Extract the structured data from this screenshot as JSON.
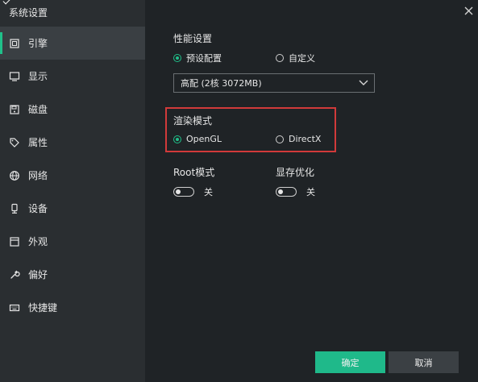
{
  "window": {
    "title": "系统设置"
  },
  "sidebar": {
    "items": [
      {
        "label": "引擎",
        "icon": "cpu-icon",
        "active": true
      },
      {
        "label": "显示",
        "icon": "monitor-icon",
        "active": false
      },
      {
        "label": "磁盘",
        "icon": "disk-icon",
        "active": false
      },
      {
        "label": "属性",
        "icon": "tag-icon",
        "active": false
      },
      {
        "label": "网络",
        "icon": "globe-icon",
        "active": false
      },
      {
        "label": "设备",
        "icon": "device-icon",
        "active": false
      },
      {
        "label": "外观",
        "icon": "window-icon",
        "active": false
      },
      {
        "label": "偏好",
        "icon": "wrench-icon",
        "active": false
      },
      {
        "label": "快捷键",
        "icon": "keyboard-icon",
        "active": false
      }
    ]
  },
  "performance": {
    "label": "性能设置",
    "options": [
      {
        "label": "预设配置",
        "selected": true
      },
      {
        "label": "自定义",
        "selected": false
      }
    ],
    "select_value": "高配 (2核 3072MB)"
  },
  "render": {
    "label": "渲染模式",
    "options": [
      {
        "label": "OpenGL",
        "selected": true
      },
      {
        "label": "DirectX",
        "selected": false
      }
    ]
  },
  "toggles": {
    "root": {
      "label": "Root模式",
      "state": "关"
    },
    "memory": {
      "label": "显存优化",
      "state": "关"
    }
  },
  "buttons": {
    "ok": "确定",
    "cancel": "取消"
  },
  "colors": {
    "accent": "#20c08a",
    "highlight": "#d13a3a",
    "sidebar": "#2a2e31",
    "content": "#1f2326"
  }
}
